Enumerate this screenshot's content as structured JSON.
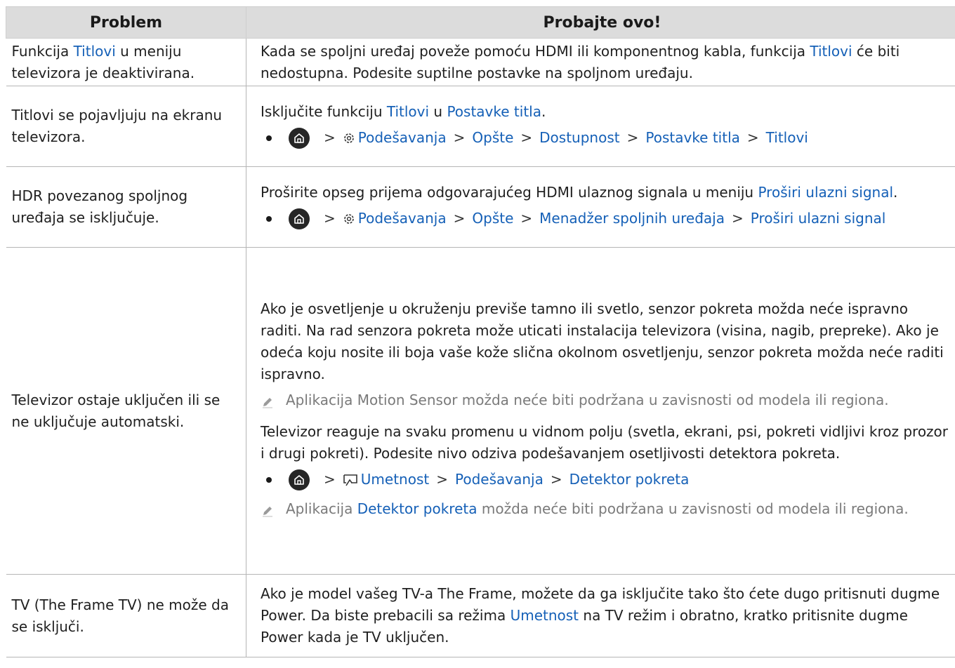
{
  "header": {
    "col1": "Problem",
    "col2": "Probajte ovo!"
  },
  "rows": {
    "r0": {
      "problem_a": "Funkcija ",
      "problem_hl": "Titlovi",
      "problem_b": " u meniju televizora je deaktivirana.",
      "text_a": "Kada se spoljni uređaj poveže pomoću HDMI ili komponentnog kabla, funkcija ",
      "text_hl": "Titlovi",
      "text_b": " će biti nedostupna. Podesite suptilne postavke na spoljnom uređaju."
    },
    "r1": {
      "problem": "Titlovi se pojavljuju na ekranu televizora.",
      "text_a": "Isključite funkciju ",
      "text_hl1": "Titlovi",
      "text_b": " u ",
      "text_hl2": "Postavke titla",
      "text_c": ".",
      "path": [
        "Podešavanja",
        "Opšte",
        "Dostupnost",
        "Postavke titla",
        "Titlovi"
      ]
    },
    "r2": {
      "problem": "HDR povezanog spoljnog uređaja se isključuje.",
      "text_a": "Proširite opseg prijema odgovarajućeg HDMI ulaznog signala u meniju ",
      "text_hl": "Proširi ulazni signal",
      "text_b": ".",
      "path": [
        "Podešavanja",
        "Opšte",
        "Menadžer spoljnih uređaja",
        "Proširi ulazni signal"
      ]
    },
    "r3": {
      "problem": "Televizor ostaje uključen ili se ne uključuje automatski.",
      "para1": "Ako je osvetljenje u okruženju previše tamno ili svetlo, senzor pokreta možda neće ispravno raditi. Na rad senzora pokreta može uticati instalacija televizora (visina, nagib, prepreke). Ako je odeća koju nosite ili boja vaše kože slična okolnom osvetljenju, senzor pokreta možda neće raditi ispravno.",
      "note1": "Aplikacija Motion Sensor možda neće biti podržana u zavisnosti od modela ili regiona.",
      "para2": "Televizor reaguje na svaku promenu u vidnom polju (svetla, ekrani, psi, pokreti vidljivi kroz prozor i drugi pokreti). Podesite nivo odziva podešavanjem osetljivosti detektora pokreta.",
      "path": [
        "Umetnost",
        "Podešavanja",
        "Detektor pokreta"
      ],
      "note2_a": "Aplikacija ",
      "note2_hl": "Detektor pokreta",
      "note2_b": " možda neće biti podržana u zavisnosti od modela ili regiona."
    },
    "r4": {
      "problem": "TV (The Frame TV) ne može da se isključi.",
      "text_a": "Ako je model vašeg TV-a The Frame, možete da ga isključite tako što ćete dugo pritisnuti dugme Power. Da biste prebacili sa režima ",
      "text_hl": "Umetnost",
      "text_b": " na TV režim i obratno, kratko pritisnite dugme Power kada je TV uključen."
    }
  },
  "colors": {
    "link": "#1560b7",
    "header_bg": "#dcdcdc",
    "note": "#7a7a7a"
  }
}
